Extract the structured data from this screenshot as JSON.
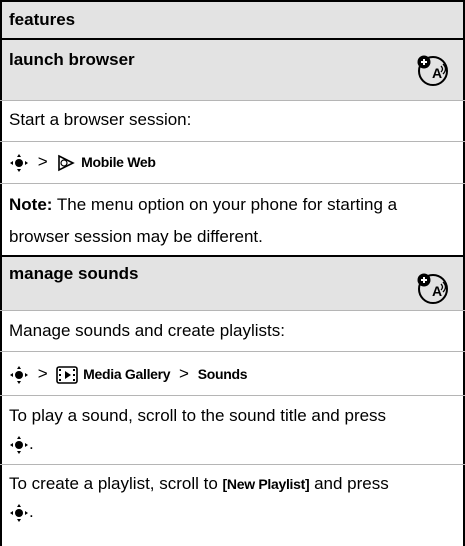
{
  "section": {
    "title": "features"
  },
  "browser": {
    "heading": "launch browser",
    "intro": "Start a browser session:",
    "path_sep": ">",
    "path_item": "Mobile Web",
    "note_label": "Note:",
    "note_line1": " The menu option on your phone for starting a",
    "note_line2": "browser session may be different."
  },
  "sounds": {
    "heading": "manage sounds",
    "intro": "Manage sounds and create playlists:",
    "path_sep1": ">",
    "path_item1": "Media Gallery",
    "path_sep2": ">",
    "path_item2": "Sounds",
    "play_line1": "To play a sound, scroll to the sound title and press",
    "play_line2": ".",
    "create_line1_a": "To create a playlist, scroll to ",
    "create_item": "[New Playlist]",
    "create_line1_b": " and press",
    "create_line2": "."
  },
  "icons": {
    "nav_key": "nav-key-icon",
    "mobile_web": "mobile-web-icon",
    "media_gallery": "media-gallery-icon",
    "network_feature": "network-feature-badge-icon"
  },
  "colors": {
    "band": "#e3e3e3",
    "rule": "#000000",
    "separator": "#b5b5b5"
  }
}
